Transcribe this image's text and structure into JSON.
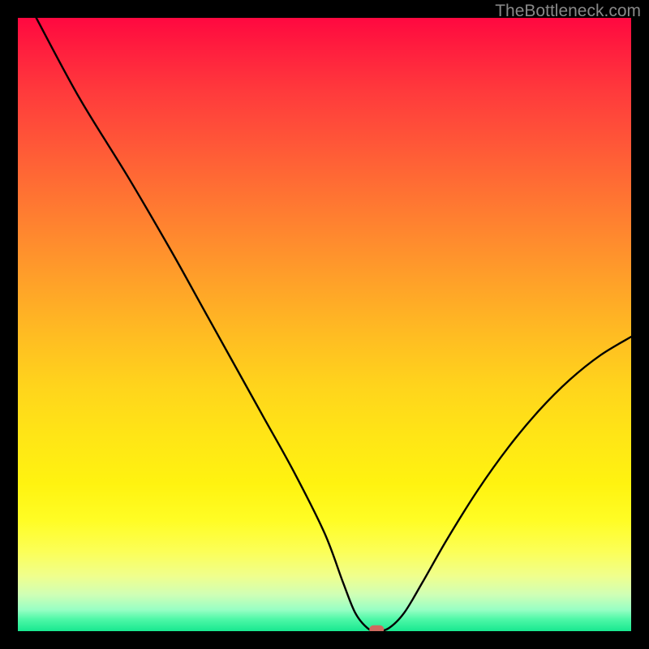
{
  "watermark": "TheBottleneck.com",
  "chart_data": {
    "type": "line",
    "title": "",
    "xlabel": "",
    "ylabel": "",
    "xlim": [
      0,
      100
    ],
    "ylim": [
      0,
      100
    ],
    "series": [
      {
        "name": "bottleneck-curve",
        "x": [
          3,
          10,
          18,
          25,
          30,
          35,
          40,
          45,
          50,
          53,
          55,
          57,
          58.5,
          60.5,
          63,
          66,
          70,
          75,
          80,
          85,
          90,
          95,
          100
        ],
        "y": [
          100,
          87,
          74,
          62,
          53,
          44,
          35,
          26,
          16,
          8,
          3,
          0.5,
          0,
          0.5,
          3,
          8,
          15,
          23,
          30,
          36,
          41,
          45,
          48
        ]
      }
    ],
    "marker": {
      "x": 58.5,
      "y": 0.3,
      "color": "#cf6a5f"
    },
    "background_gradient": {
      "top_color": "#ff0840",
      "bottom_color": "#18e890"
    }
  }
}
